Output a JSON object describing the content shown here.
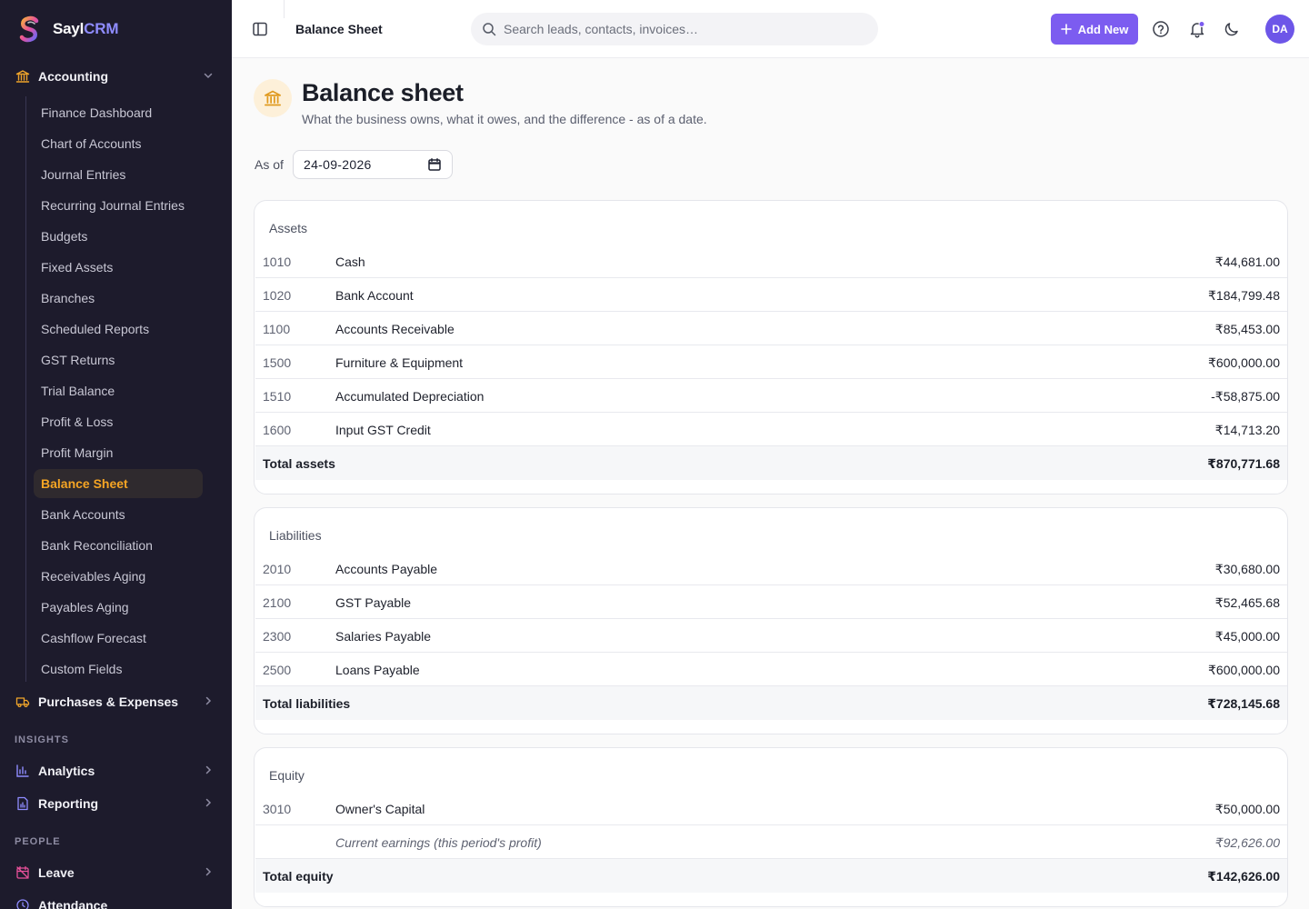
{
  "app": {
    "name_part1": "Sayl",
    "name_part2": "CRM"
  },
  "sidebar": {
    "accounting": {
      "label": "Accounting",
      "icon": "bank-icon"
    },
    "sub_items": [
      {
        "label": "Finance Dashboard",
        "active": false
      },
      {
        "label": "Chart of Accounts",
        "active": false
      },
      {
        "label": "Journal Entries",
        "active": false
      },
      {
        "label": "Recurring Journal Entries",
        "active": false
      },
      {
        "label": "Budgets",
        "active": false
      },
      {
        "label": "Fixed Assets",
        "active": false
      },
      {
        "label": "Branches",
        "active": false
      },
      {
        "label": "Scheduled Reports",
        "active": false
      },
      {
        "label": "GST Returns",
        "active": false
      },
      {
        "label": "Trial Balance",
        "active": false
      },
      {
        "label": "Profit & Loss",
        "active": false
      },
      {
        "label": "Profit Margin",
        "active": false
      },
      {
        "label": "Balance Sheet",
        "active": true
      },
      {
        "label": "Bank Accounts",
        "active": false
      },
      {
        "label": "Bank Reconciliation",
        "active": false
      },
      {
        "label": "Receivables Aging",
        "active": false
      },
      {
        "label": "Payables Aging",
        "active": false
      },
      {
        "label": "Cashflow Forecast",
        "active": false
      },
      {
        "label": "Custom Fields",
        "active": false
      }
    ],
    "purchases": {
      "label": "Purchases & Expenses",
      "icon": "truck-icon"
    },
    "insights_label": "INSIGHTS",
    "analytics": {
      "label": "Analytics",
      "icon": "bar-chart-icon"
    },
    "reporting": {
      "label": "Reporting",
      "icon": "report-icon"
    },
    "people_label": "PEOPLE",
    "leave": {
      "label": "Leave",
      "icon": "calendar-off-icon"
    },
    "attendance": {
      "label": "Attendance",
      "icon": "clock-icon"
    }
  },
  "topbar": {
    "breadcrumb": "Balance Sheet",
    "search_placeholder": "Search leads, contacts, invoices…",
    "add_new_label": "Add New",
    "avatar_initials": "DA"
  },
  "page": {
    "title": "Balance sheet",
    "subtitle": "What the business owns, what it owes, and the difference - as of a date.",
    "as_of_label": "As of",
    "as_of_date": "24-09-2026"
  },
  "assets": {
    "title": "Assets",
    "rows": [
      {
        "code": "1010",
        "name": "Cash",
        "amount": "₹44,681.00"
      },
      {
        "code": "1020",
        "name": "Bank Account",
        "amount": "₹184,799.48"
      },
      {
        "code": "1100",
        "name": "Accounts Receivable",
        "amount": "₹85,453.00"
      },
      {
        "code": "1500",
        "name": "Furniture & Equipment",
        "amount": "₹600,000.00"
      },
      {
        "code": "1510",
        "name": "Accumulated Depreciation",
        "amount": "-₹58,875.00"
      },
      {
        "code": "1600",
        "name": "Input GST Credit",
        "amount": "₹14,713.20"
      }
    ],
    "total_label": "Total assets",
    "total_amount": "₹870,771.68"
  },
  "liabilities": {
    "title": "Liabilities",
    "rows": [
      {
        "code": "2010",
        "name": "Accounts Payable",
        "amount": "₹30,680.00"
      },
      {
        "code": "2100",
        "name": "GST Payable",
        "amount": "₹52,465.68"
      },
      {
        "code": "2300",
        "name": "Salaries Payable",
        "amount": "₹45,000.00"
      },
      {
        "code": "2500",
        "name": "Loans Payable",
        "amount": "₹600,000.00"
      }
    ],
    "total_label": "Total liabilities",
    "total_amount": "₹728,145.68"
  },
  "equity": {
    "title": "Equity",
    "rows": [
      {
        "code": "3010",
        "name": "Owner's Capital",
        "amount": "₹50,000.00"
      },
      {
        "code": "",
        "name": "Current earnings (this period's profit)",
        "amount": "₹92,626.00"
      }
    ],
    "total_label": "Total equity",
    "total_amount": "₹142,626.00"
  },
  "colors": {
    "sidebar_bg": "#1d1b2c",
    "accent": "#7c5cf0",
    "active_item": "#f5a524",
    "icon_amber": "#f0a52a"
  }
}
